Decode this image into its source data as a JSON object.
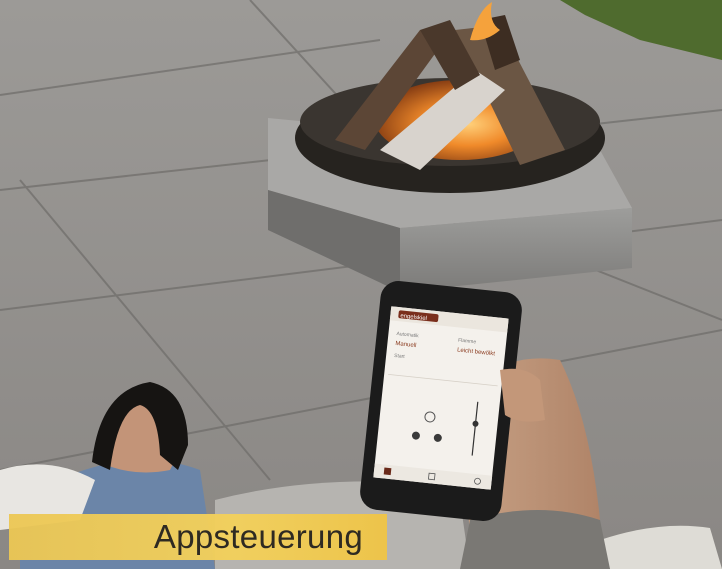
{
  "caption": {
    "text": "Appsteuerung",
    "color": "#f0cc5c"
  },
  "phone_screen": {
    "brand": "engelskiel",
    "label_left": "Automatik",
    "label_right": "Flamme",
    "value_left": "Manuell",
    "value_right": "Leicht bewölkt",
    "item": "Start",
    "mode_icon": "flame-icon",
    "nav_icons": [
      "home-icon",
      "grid-icon",
      "settings-icon"
    ]
  }
}
